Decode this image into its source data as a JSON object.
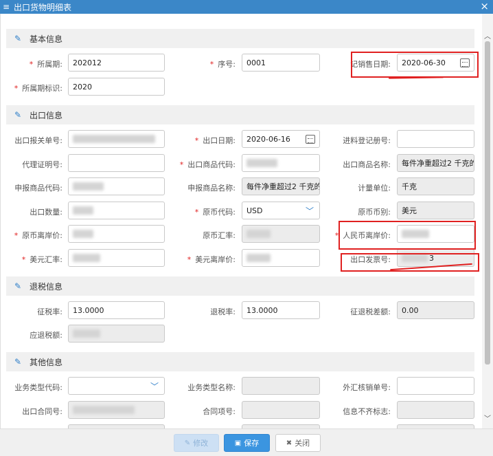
{
  "window": {
    "title": "出口货物明细表",
    "close_glyph": "×"
  },
  "sections": {
    "basic": "基本信息",
    "export": "出口信息",
    "tax": "退税信息",
    "other": "其他信息"
  },
  "basic": {
    "period_label": "所属期:",
    "period_value": "202012",
    "seq_label": "序号:",
    "seq_value": "0001",
    "sale_date_label": "记销售日期:",
    "sale_date_value": "2020-06-30",
    "period_flag_label": "所属期标识:",
    "period_flag_value": "2020"
  },
  "export": {
    "customs_no_label": "出口报关单号:",
    "export_date_label": "出口日期:",
    "export_date_value": "2020-06-16",
    "processing_no_label": "进料登记册号:",
    "agency_cert_label": "代理证明号:",
    "goods_code_label": "出口商品代码:",
    "goods_name_label": "出口商品名称:",
    "goods_name_value": "每件净重超过2 千克的",
    "decl_code_label": "申报商品代码:",
    "decl_name_label": "申报商品名称:",
    "decl_name_value": "每件净重超过2 千克的",
    "unit_label": "计量单位:",
    "unit_value": "千克",
    "qty_label": "出口数量:",
    "currency_code_label": "原币代码:",
    "currency_code_value": "USD",
    "currency_label": "原币币别:",
    "currency_value": "美元",
    "orig_fob_label": "原币离岸价:",
    "orig_rate_label": "原币汇率:",
    "rmb_fob_label": "人民币离岸价:",
    "usd_rate_label": "美元汇率:",
    "usd_fob_label": "美元离岸价:",
    "invoice_label": "出口发票号:",
    "invoice_tail": "3"
  },
  "tax": {
    "levy_rate_label": "征税率:",
    "levy_rate_value": "13.0000",
    "refund_rate_label": "退税率:",
    "refund_rate_value": "13.0000",
    "diff_label": "征退税差额:",
    "diff_value": "0.00",
    "refund_amount_label": "应退税额:"
  },
  "other": {
    "biz_type_code_label": "业务类型代码:",
    "biz_type_name_label": "业务类型名称:",
    "fx_no_label": "外汇核销单号:",
    "contract_no_label": "出口合同号:",
    "contract_item_label": "合同项号:",
    "info_flag_label": "信息不齐标志:"
  },
  "footer": {
    "modify": "修改",
    "save": "保存",
    "close": "关闭"
  },
  "colors": {
    "titlebar": "#3b87c8",
    "required": "#e02020",
    "annotation": "#e02020",
    "save_button": "#3b95e0"
  }
}
